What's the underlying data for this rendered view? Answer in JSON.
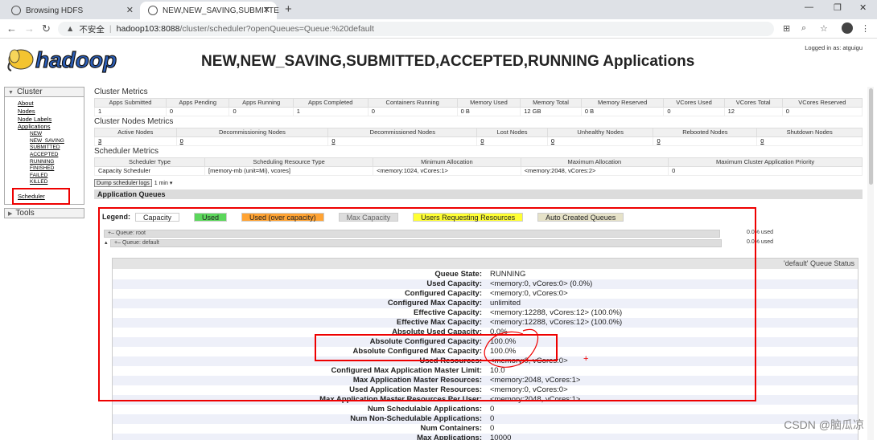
{
  "browser": {
    "tabs": [
      {
        "title": "Browsing HDFS"
      },
      {
        "title": "NEW,NEW_SAVING,SUBMITTE"
      }
    ],
    "address": {
      "security": "不安全",
      "host": "hadoop103:8088",
      "path": "/cluster/scheduler?openQueues=Queue:%20default"
    }
  },
  "header": {
    "logo_text": "hadoop",
    "title": "NEW,NEW_SAVING,SUBMITTED,ACCEPTED,RUNNING Applications",
    "logged_in": "Logged in as: atguigu"
  },
  "nav": {
    "cluster_label": "Cluster",
    "links": [
      "About",
      "Nodes",
      "Node Labels",
      "Applications"
    ],
    "app_states": [
      "NEW",
      "NEW_SAVING",
      "SUBMITTED",
      "ACCEPTED",
      "RUNNING",
      "FINISHED",
      "FAILED",
      "KILLED"
    ],
    "scheduler": "Scheduler",
    "tools_label": "Tools"
  },
  "cluster_metrics": {
    "title": "Cluster Metrics",
    "headers": [
      "Apps Submitted",
      "Apps Pending",
      "Apps Running",
      "Apps Completed",
      "Containers Running",
      "Memory Used",
      "Memory Total",
      "Memory Reserved",
      "VCores Used",
      "VCores Total",
      "VCores Reserved"
    ],
    "values": [
      "1",
      "0",
      "0",
      "1",
      "0",
      "0 B",
      "12 GB",
      "0 B",
      "0",
      "12",
      "0"
    ]
  },
  "node_metrics": {
    "title": "Cluster Nodes Metrics",
    "headers": [
      "Active Nodes",
      "Decommissioning Nodes",
      "Decommissioned Nodes",
      "Lost Nodes",
      "Unhealthy Nodes",
      "Rebooted Nodes",
      "Shutdown Nodes"
    ],
    "values": [
      "3",
      "0",
      "0",
      "0",
      "0",
      "0",
      "0"
    ]
  },
  "scheduler_metrics": {
    "title": "Scheduler Metrics",
    "headers": [
      "Scheduler Type",
      "Scheduling Resource Type",
      "Minimum Allocation",
      "Maximum Allocation",
      "Maximum Cluster Application Priority"
    ],
    "values": [
      "Capacity Scheduler",
      "[memory-mb (unit=Mi), vcores]",
      "<memory:1024, vCores:1>",
      "<memory:2048, vCores:2>",
      "0"
    ]
  },
  "dump": {
    "button": "Dump scheduler logs",
    "select": "1 min"
  },
  "queues": {
    "section_title": "Application Queues",
    "legend_label": "Legend:",
    "legend": [
      {
        "label": "Capacity",
        "color": "#eeeeee"
      },
      {
        "label": "Used",
        "color": "#5bd75b"
      },
      {
        "label": "Used (over capacity)",
        "color": "#ffa333"
      },
      {
        "label": "Max Capacity",
        "color": "#dddddd"
      },
      {
        "label": "Users Requesting Resources",
        "color": "#ffff33"
      },
      {
        "label": "Auto Created Queues",
        "color": "#e6e2c8"
      }
    ],
    "root": {
      "label": "Queue: root",
      "used": "0.0% used"
    },
    "default": {
      "label": "Queue: default",
      "used": "0.0% used"
    }
  },
  "status": {
    "title": "'default' Queue Status",
    "rows": [
      {
        "k": "Queue State:",
        "v": "RUNNING"
      },
      {
        "k": "Used Capacity:",
        "v": "<memory:0, vCores:0> (0.0%)"
      },
      {
        "k": "Configured Capacity:",
        "v": "<memory:0, vCores:0>"
      },
      {
        "k": "Configured Max Capacity:",
        "v": "unlimited"
      },
      {
        "k": "Effective Capacity:",
        "v": "<memory:12288, vCores:12> (100.0%)"
      },
      {
        "k": "Effective Max Capacity:",
        "v": "<memory:12288, vCores:12> (100.0%)"
      },
      {
        "k": "Absolute Used Capacity:",
        "v": "0.0%"
      },
      {
        "k": "Absolute Configured Capacity:",
        "v": "100.0%"
      },
      {
        "k": "Absolute Configured Max Capacity:",
        "v": "100.0%"
      },
      {
        "k": "Used Resources:",
        "v": "<memory:0, vCores:0>"
      },
      {
        "k": "Configured Max Application Master Limit:",
        "v": "10.0"
      },
      {
        "k": "Max Application Master Resources:",
        "v": "<memory:2048, vCores:1>"
      },
      {
        "k": "Used Application Master Resources:",
        "v": "<memory:0, vCores:0>"
      },
      {
        "k": "Max Application Master Resources Per User:",
        "v": "<memory:2048, vCores:1>"
      },
      {
        "k": "Num Schedulable Applications:",
        "v": "0"
      },
      {
        "k": "Num Non-Schedulable Applications:",
        "v": "0"
      },
      {
        "k": "Num Containers:",
        "v": "0"
      },
      {
        "k": "Max Applications:",
        "v": "10000"
      }
    ]
  },
  "watermark": "CSDN @脑瓜凉"
}
